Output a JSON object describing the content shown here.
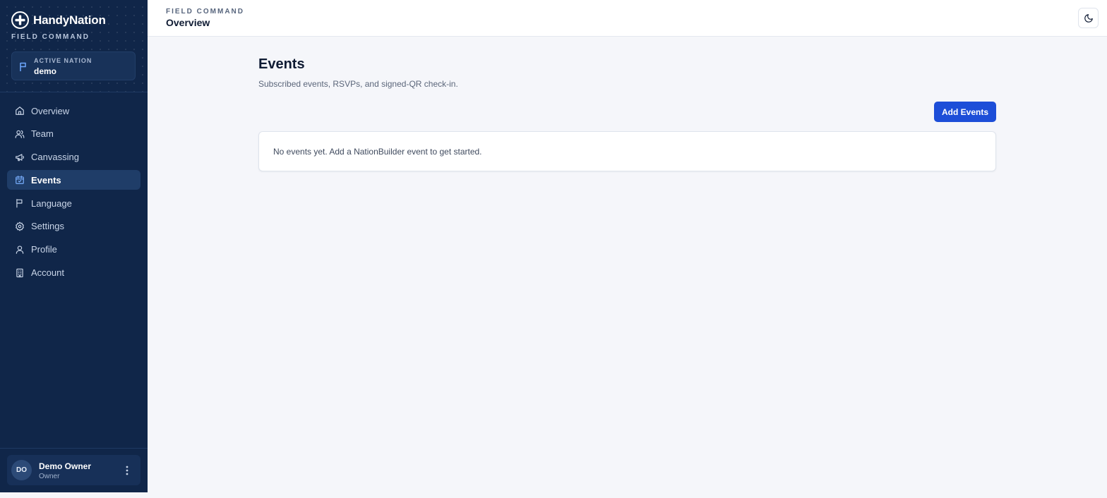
{
  "brand": {
    "name": "HandyNation",
    "subtitle": "FIELD COMMAND"
  },
  "active_nation": {
    "label": "ACTIVE NATION",
    "value": "demo"
  },
  "nav": {
    "items": [
      {
        "label": "Overview",
        "icon": "home-icon",
        "active": false
      },
      {
        "label": "Team",
        "icon": "users-icon",
        "active": false
      },
      {
        "label": "Canvassing",
        "icon": "megaphone-icon",
        "active": false
      },
      {
        "label": "Events",
        "icon": "calendar-check-icon",
        "active": true
      },
      {
        "label": "Language",
        "icon": "flag-icon",
        "active": false
      },
      {
        "label": "Settings",
        "icon": "gear-icon",
        "active": false
      },
      {
        "label": "Profile",
        "icon": "user-icon",
        "active": false
      },
      {
        "label": "Account",
        "icon": "building-icon",
        "active": false
      }
    ]
  },
  "user": {
    "initials": "DO",
    "name": "Demo Owner",
    "role": "Owner"
  },
  "header": {
    "kicker": "FIELD COMMAND",
    "title": "Overview",
    "theme_icon": "moon-icon"
  },
  "main": {
    "title": "Events",
    "subtitle": "Subscribed events, RSVPs, and signed-QR check-in.",
    "add_button": "Add Events",
    "empty_message": "No events yet. Add a NationBuilder event to get started."
  },
  "colors": {
    "sidebar": "#102649",
    "accent": "#1d4ed8",
    "background": "#f5f6fa"
  }
}
